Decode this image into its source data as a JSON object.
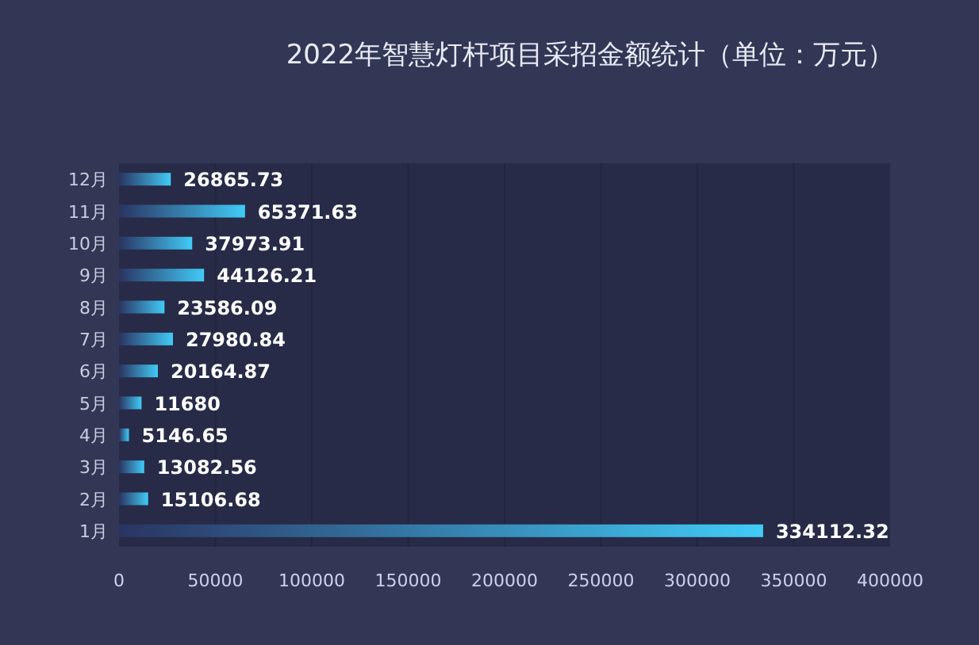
{
  "chart": {
    "chart_data": {
      "type": "bar",
      "orientation": "horizontal",
      "title": "2022年智慧灯杆项目采招金额统计（单位：万元）",
      "categories": [
        "12月",
        "11月",
        "10月",
        "9月",
        "8月",
        "7月",
        "6月",
        "5月",
        "4月",
        "3月",
        "2月",
        "1月"
      ],
      "values": [
        26865.73,
        65371.63,
        37973.91,
        44126.21,
        23586.09,
        27980.84,
        20164.87,
        11680,
        5146.65,
        13082.56,
        15106.68,
        334112.32
      ],
      "xlim": [
        0,
        400000
      ],
      "xticks": [
        0,
        50000,
        100000,
        150000,
        200000,
        250000,
        300000,
        350000,
        400000
      ],
      "grid": true,
      "data_labels": true
    }
  }
}
